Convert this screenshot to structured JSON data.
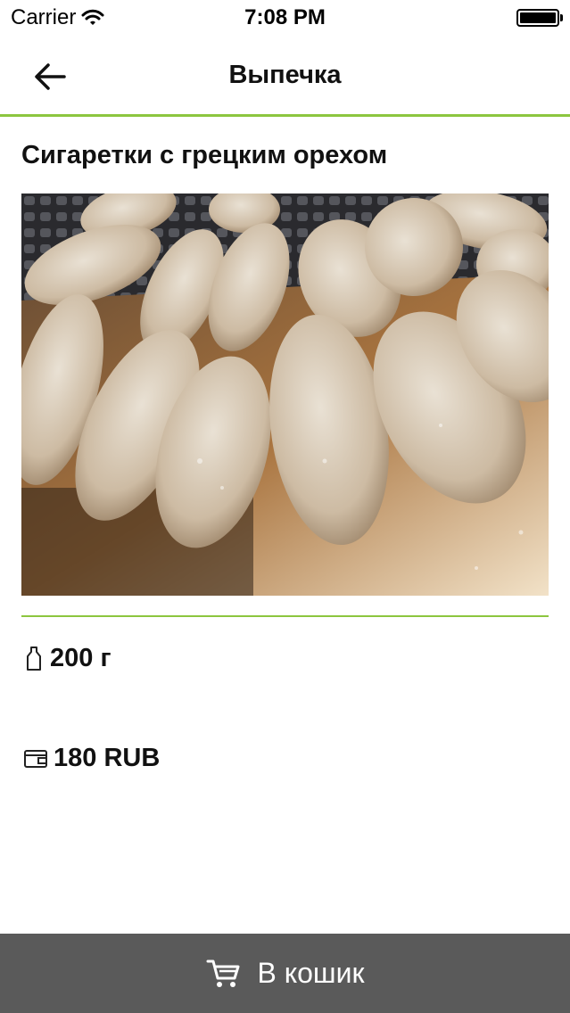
{
  "status_bar": {
    "carrier": "Carrier",
    "time": "7:08 PM"
  },
  "nav": {
    "title": "Выпечка",
    "back_icon": "arrow-left-icon",
    "accent_color": "#8cc63f"
  },
  "product": {
    "title": "Сигаретки с грецким орехом",
    "weight": "200 г",
    "price": "180 RUB",
    "weight_icon": "bottle-icon",
    "price_icon": "wallet-icon"
  },
  "cart_button": {
    "label": "В кошик",
    "icon": "cart-icon",
    "background": "#5a5a5a"
  }
}
